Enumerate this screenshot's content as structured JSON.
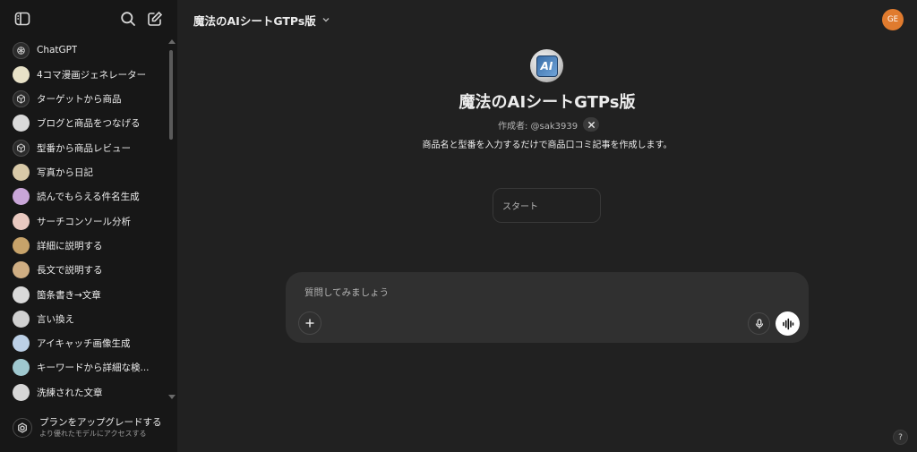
{
  "sidebar": {
    "items": [
      {
        "label": "ChatGPT",
        "icon": "openai-icon",
        "color": "#2b2b2b"
      },
      {
        "label": "4コマ漫画ジェネレーター",
        "icon": "pencil-comic-icon",
        "color": "#e8e2c8"
      },
      {
        "label": "ターゲットから商品",
        "icon": "cube-icon",
        "color": "#2b2b2b"
      },
      {
        "label": "ブログと商品をつなげる",
        "icon": "blog-thumbnail-icon",
        "color": "#d9d9d9"
      },
      {
        "label": "型番から商品レビュー",
        "icon": "cube-icon",
        "color": "#2b2b2b"
      },
      {
        "label": "写真から日記",
        "icon": "photo-diary-icon",
        "color": "#d8c9a8"
      },
      {
        "label": "読んでもらえる件名生成",
        "icon": "feather-icon",
        "color": "#c9a6d8"
      },
      {
        "label": "サーチコンソール分析",
        "icon": "analytics-icon",
        "color": "#e9c9c0"
      },
      {
        "label": "詳細に説明する",
        "icon": "map-icon",
        "color": "#c7a36a"
      },
      {
        "label": "長文で説明する",
        "icon": "writer-icon",
        "color": "#cfae83"
      },
      {
        "label": "箇条書き→文章",
        "icon": "list-icon",
        "color": "#d9d9d9"
      },
      {
        "label": "言い換え",
        "icon": "paraphrase-icon",
        "color": "#d0d0d0"
      },
      {
        "label": "アイキャッチ画像生成",
        "icon": "image-icon",
        "color": "#bcd0e6"
      },
      {
        "label": "キーワードから詳細な検...",
        "icon": "search-globe-icon",
        "color": "#9fc8cf"
      },
      {
        "label": "洗練された文章",
        "icon": "quill-icon",
        "color": "#d6d6d6"
      }
    ],
    "upgrade": {
      "title": "プランをアップグレードする",
      "subtitle": "より優れたモデルにアクセスする"
    }
  },
  "header": {
    "title": "魔法のAIシートGTPs版",
    "user_initials": "GE",
    "user_color": "#e07b2e"
  },
  "gpt": {
    "logo_text": "AI",
    "name": "魔法のAIシートGTPs版",
    "author": "作成者: @sak3939",
    "description": "商品名と型番を入力するだけで商品口コミ記事を作成します。",
    "starters": [
      "スタート"
    ]
  },
  "composer": {
    "placeholder": "質問してみましょう"
  },
  "help": {
    "label": "?"
  }
}
